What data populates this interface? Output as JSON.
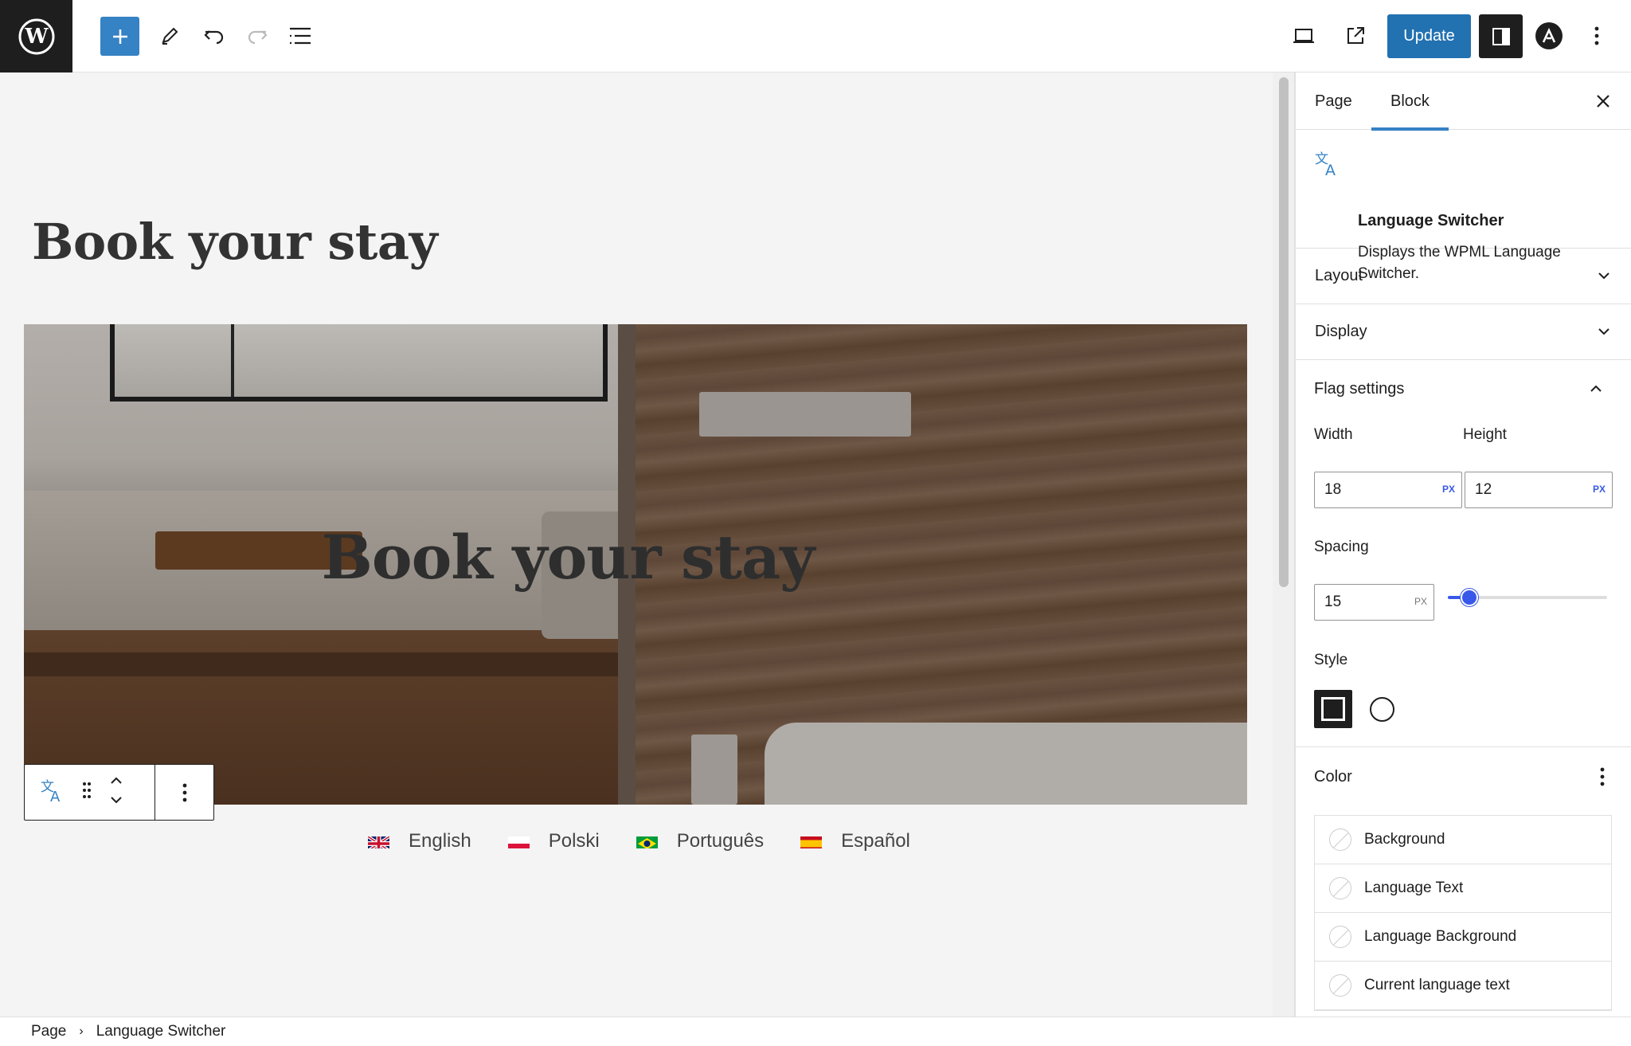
{
  "toolbar": {
    "update_label": "Update"
  },
  "canvas": {
    "page_title": "Book your stay",
    "cover_title": "Book your stay",
    "languages": [
      {
        "name": "English",
        "flag": "uk"
      },
      {
        "name": "Polski",
        "flag": "pl"
      },
      {
        "name": "Português",
        "flag": "br"
      },
      {
        "name": "Español",
        "flag": "es"
      }
    ]
  },
  "breadcrumb": {
    "items": [
      "Page",
      "Language Switcher"
    ]
  },
  "sidebar": {
    "tabs": [
      "Page",
      "Block"
    ],
    "active_tab": "Block",
    "block": {
      "title": "Language Switcher",
      "description": "Displays the WPML Language Switcher."
    },
    "panels": {
      "layout": "Layout",
      "display": "Display",
      "flag_settings": "Flag settings"
    },
    "flag": {
      "width_label": "Width",
      "height_label": "Height",
      "width_value": "18",
      "height_value": "12",
      "unit": "PX",
      "spacing_label": "Spacing",
      "spacing_value": "15",
      "spacing_unit": "PX",
      "style_label": "Style"
    },
    "color": {
      "heading": "Color",
      "items": [
        "Background",
        "Language Text",
        "Language Background",
        "Current language text"
      ]
    }
  },
  "colors": {
    "accent": "#3582c4",
    "update": "#2271b1",
    "slider": "#3858e9"
  }
}
